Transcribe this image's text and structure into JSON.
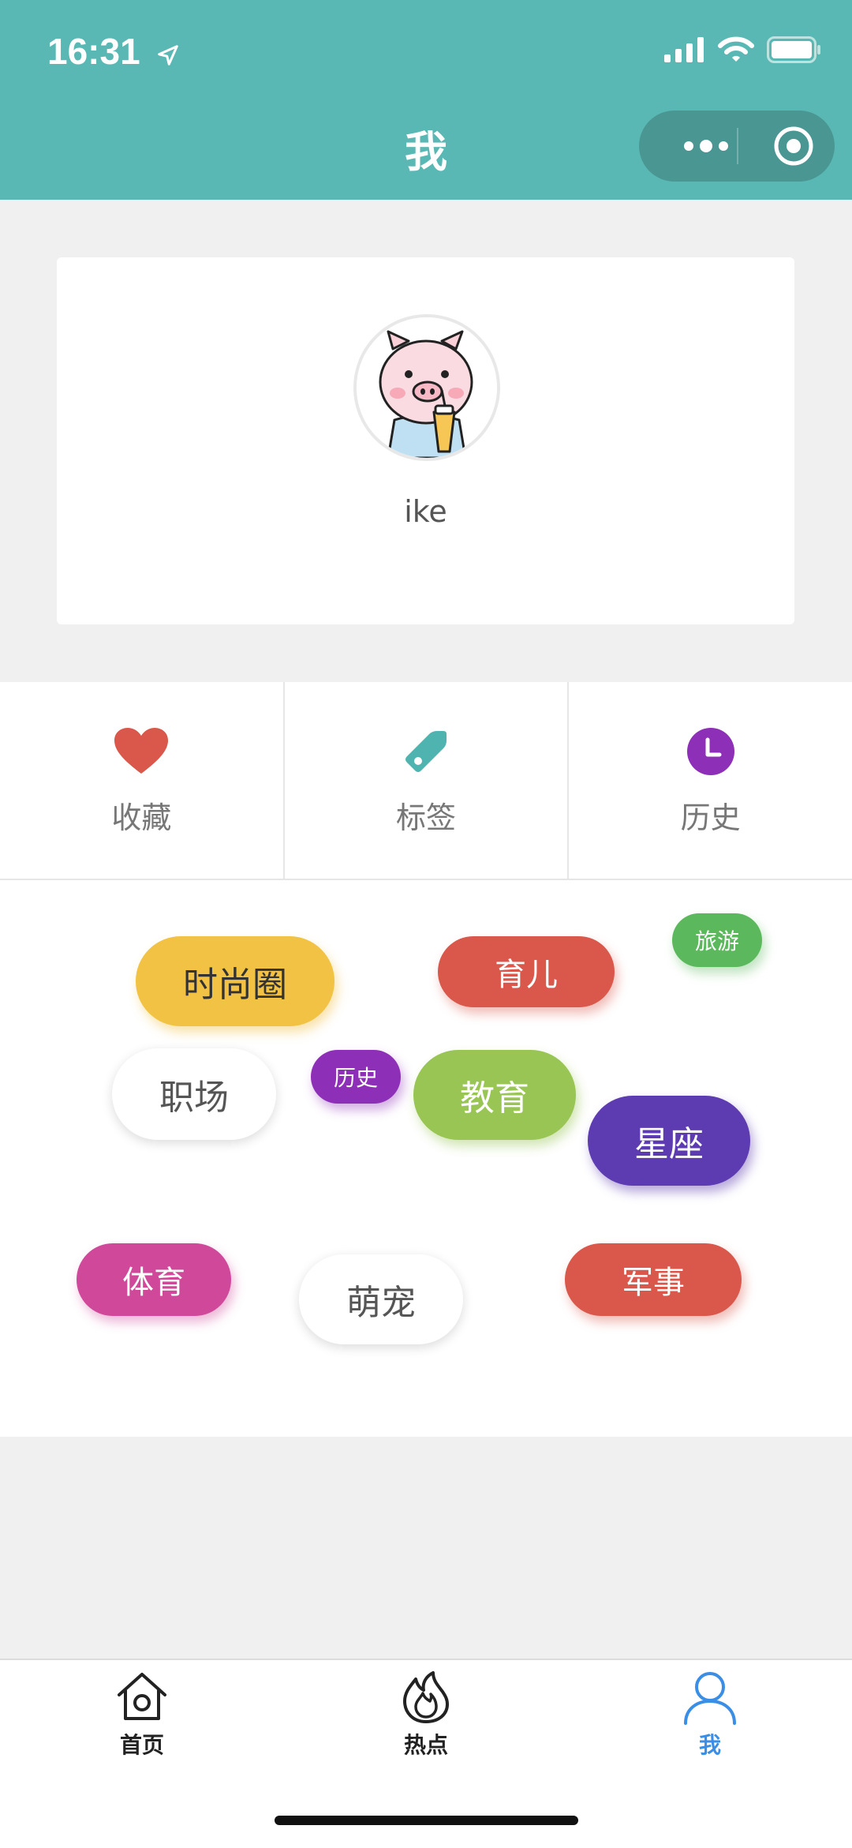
{
  "status_bar": {
    "time": "16:31"
  },
  "header": {
    "title": "我"
  },
  "profile": {
    "username": "ike"
  },
  "menu": [
    {
      "label": "收藏",
      "icon": "heart-icon",
      "color": "#d9574b"
    },
    {
      "label": "标签",
      "icon": "tag-icon",
      "color": "#4fb3b0"
    },
    {
      "label": "历史",
      "icon": "clock-icon",
      "color": "#8e2fb8"
    }
  ],
  "tags": [
    {
      "label": "时尚圈",
      "bg": "#f2c245",
      "fg": "#333333"
    },
    {
      "label": "育儿",
      "bg": "#d9574b",
      "fg": "#ffffff"
    },
    {
      "label": "旅游",
      "bg": "#5cb85c",
      "fg": "#ffffff"
    },
    {
      "label": "职场",
      "bg": "#ffffff",
      "fg": "#555555"
    },
    {
      "label": "历史",
      "bg": "#8e2fb8",
      "fg": "#ffffff"
    },
    {
      "label": "教育",
      "bg": "#98c554",
      "fg": "#ffffff"
    },
    {
      "label": "星座",
      "bg": "#5d3bb0",
      "fg": "#ffffff"
    },
    {
      "label": "体育",
      "bg": "#d0489a",
      "fg": "#ffffff"
    },
    {
      "label": "萌宠",
      "bg": "#ffffff",
      "fg": "#555555"
    },
    {
      "label": "军事",
      "bg": "#d9574b",
      "fg": "#ffffff"
    }
  ],
  "tabbar": [
    {
      "label": "首页",
      "icon": "home-icon"
    },
    {
      "label": "热点",
      "icon": "fire-icon"
    },
    {
      "label": "我",
      "icon": "user-icon",
      "active": true
    }
  ]
}
